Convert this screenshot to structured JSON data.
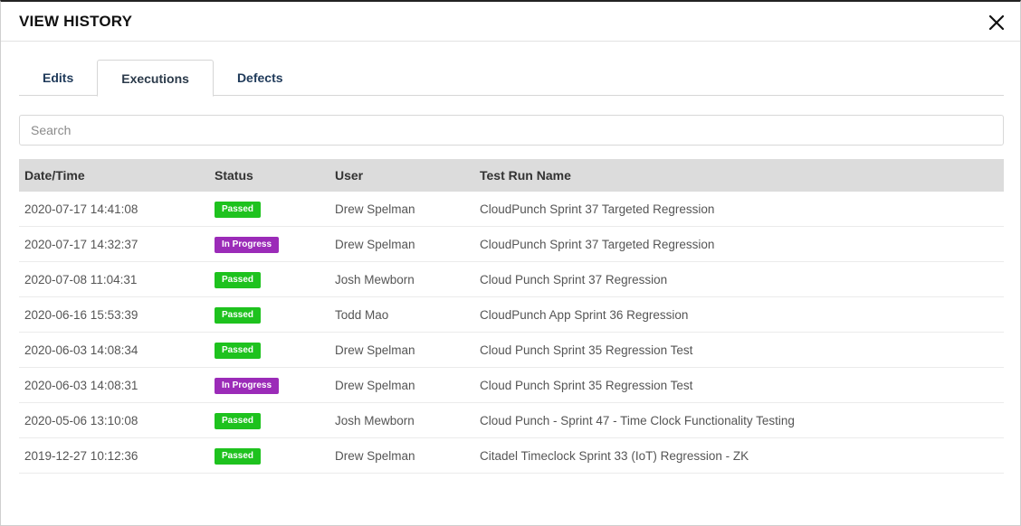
{
  "header": {
    "title": "VIEW HISTORY"
  },
  "tabs": [
    {
      "label": "Edits",
      "active": false
    },
    {
      "label": "Executions",
      "active": true
    },
    {
      "label": "Defects",
      "active": false
    }
  ],
  "search": {
    "placeholder": "Search",
    "value": ""
  },
  "table": {
    "columns": [
      "Date/Time",
      "Status",
      "User",
      "Test Run Name"
    ],
    "rows": [
      {
        "datetime": "2020-07-17 14:41:08",
        "status": "Passed",
        "user": "Drew Spelman",
        "name": "CloudPunch Sprint 37 Targeted Regression"
      },
      {
        "datetime": "2020-07-17 14:32:37",
        "status": "In Progress",
        "user": "Drew Spelman",
        "name": "CloudPunch Sprint 37 Targeted Regression"
      },
      {
        "datetime": "2020-07-08 11:04:31",
        "status": "Passed",
        "user": "Josh Mewborn",
        "name": "Cloud Punch Sprint 37 Regression"
      },
      {
        "datetime": "2020-06-16 15:53:39",
        "status": "Passed",
        "user": "Todd Mao",
        "name": "CloudPunch App Sprint 36 Regression"
      },
      {
        "datetime": "2020-06-03 14:08:34",
        "status": "Passed",
        "user": "Drew Spelman",
        "name": "Cloud Punch Sprint 35 Regression Test"
      },
      {
        "datetime": "2020-06-03 14:08:31",
        "status": "In Progress",
        "user": "Drew Spelman",
        "name": "Cloud Punch Sprint 35 Regression Test"
      },
      {
        "datetime": "2020-05-06 13:10:08",
        "status": "Passed",
        "user": "Josh Mewborn",
        "name": "Cloud Punch - Sprint 47 - Time Clock Functionality Testing"
      },
      {
        "datetime": "2019-12-27 10:12:36",
        "status": "Passed",
        "user": "Drew Spelman",
        "name": "Citadel Timeclock Sprint 33 (IoT) Regression - ZK"
      }
    ]
  },
  "colors": {
    "passed": "#1ec21e",
    "in_progress": "#9b2bb8",
    "tab_text": "#1f3a5a",
    "header_bg": "#dcdcdc"
  },
  "icons": {
    "close": "close-icon"
  }
}
